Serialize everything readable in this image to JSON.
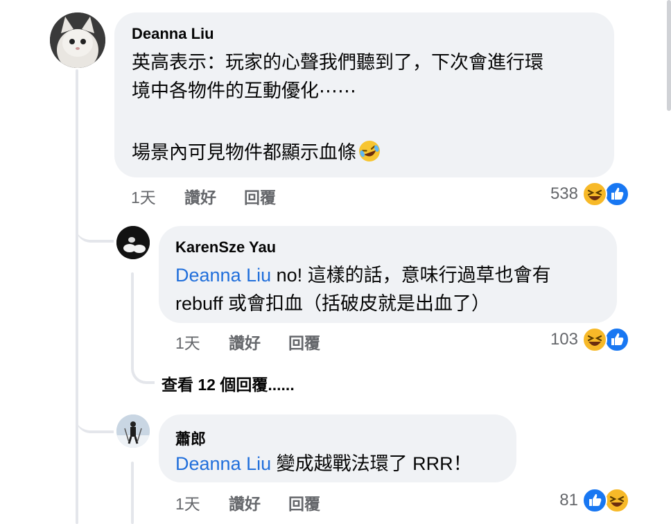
{
  "comment": {
    "author": "Deanna Liu",
    "text_lines": [
      "英高表示：玩家的心聲我們聽到了，下次會進行環",
      "境中各物件的互動優化⋯⋯"
    ],
    "text_extra": "場景內可見物件都顯示血條",
    "emoji": "🤣",
    "time": "1天",
    "like_label": "讚好",
    "reply_label": "回覆",
    "reaction_count": "538",
    "reactions": [
      "haha-icon",
      "like-icon"
    ]
  },
  "replies": [
    {
      "author": "KarenSze Yau",
      "mention": "Deanna Liu",
      "text_line1": " no! 這樣的話，意味行過草也會有",
      "text_line2": "rebuff 或會扣血（括破皮就是出血了）",
      "time": "1天",
      "like_label": "讚好",
      "reply_label": "回覆",
      "reaction_count": "103",
      "reactions": [
        "haha-icon",
        "like-icon"
      ]
    },
    {
      "author": "蕭郎",
      "mention": "Deanna Liu",
      "text_line1": " 變成越戰法環了 RRR！",
      "time": "1天",
      "like_label": "讚好",
      "reply_label": "回覆",
      "reaction_count": "81",
      "reactions": [
        "like-icon",
        "haha-icon"
      ]
    }
  ],
  "view_more_replies": "查看 12 個回覆......",
  "colors": {
    "bubble": "#f0f2f5",
    "mention": "#216fdb",
    "meta": "#65676b",
    "like": "#1877f2",
    "haha": "#f7b928"
  }
}
